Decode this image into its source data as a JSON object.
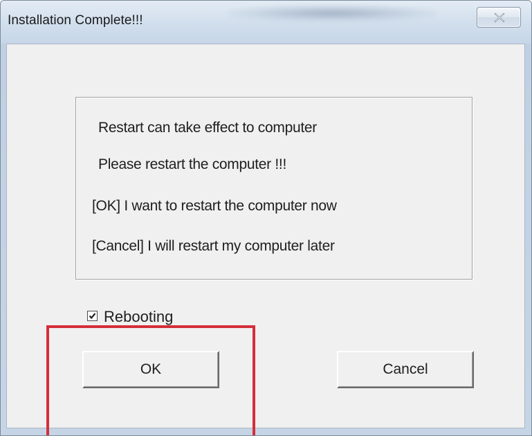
{
  "window": {
    "title": "Installation Complete!!!"
  },
  "message": {
    "lines": [
      "Restart can take effect to computer",
      "Please restart the computer !!!",
      "[OK] I want to restart the computer now",
      "[Cancel] I will restart my computer later"
    ]
  },
  "reboot_checkbox": {
    "label": "Rebooting",
    "checked": true
  },
  "buttons": {
    "ok_label": "OK",
    "cancel_label": "Cancel"
  },
  "annotation": {
    "highlight_color": "#d32f3a"
  },
  "icons": {
    "close": "close-icon",
    "check": "checkmark-icon"
  }
}
